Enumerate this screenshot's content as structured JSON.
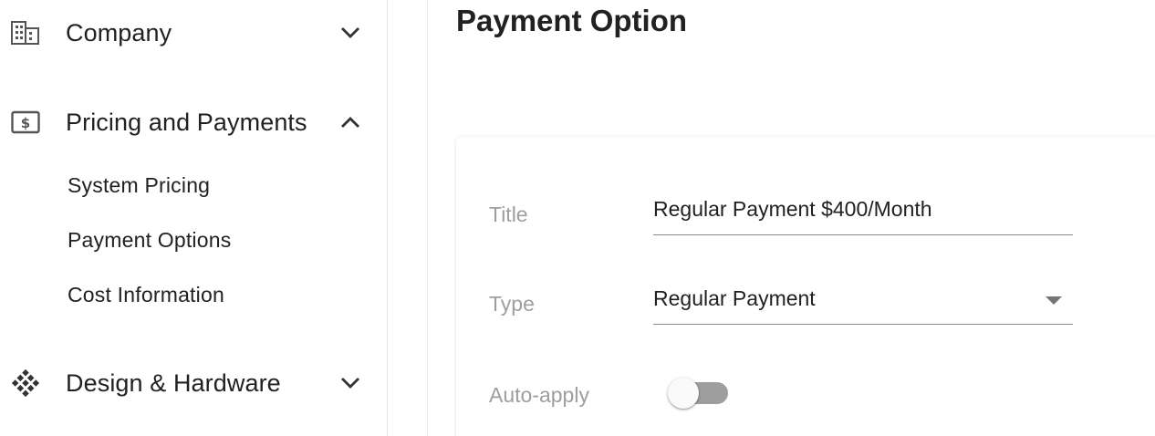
{
  "sidebar": {
    "sections": [
      {
        "label": "Company",
        "icon": "building-icon",
        "expanded": false
      },
      {
        "label": "Pricing and Payments",
        "icon": "money-icon",
        "expanded": true
      },
      {
        "label": "Design & Hardware",
        "icon": "grid-diamond-icon",
        "expanded": false
      }
    ],
    "subitems": [
      "System Pricing",
      "Payment Options",
      "Cost Information"
    ]
  },
  "main": {
    "title": "Payment Option",
    "form": {
      "title_label": "Title",
      "title_value": "Regular Payment $400/Month",
      "type_label": "Type",
      "type_value": "Regular Payment",
      "autoapply_label": "Auto-apply",
      "autoapply_on": false
    }
  }
}
